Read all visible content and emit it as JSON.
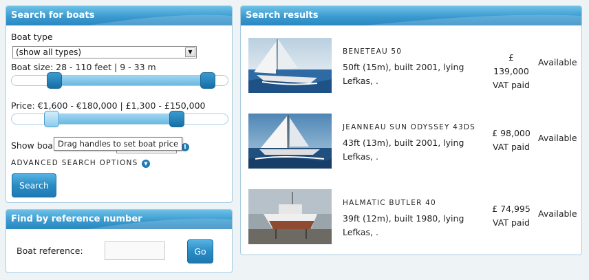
{
  "search_panel": {
    "title": "Search for boats",
    "boat_type_label": "Boat type",
    "boat_type_value": "(show all types)",
    "boat_size_label": "Boat size: 28 - 110 feet | 9 - 33 m",
    "price_label": "Price: €1,600 - €180,000 | £1,300 - £150,000",
    "show_label": "Show boa",
    "tooltip": "Drag handles to set boat price",
    "advanced_label": "ADVANCED SEARCH OPTIONS",
    "search_button": "Search"
  },
  "reference_panel": {
    "title": "Find by reference number",
    "reference_label": "Boat reference:",
    "reference_value": "",
    "go_button": "Go"
  },
  "results_panel": {
    "title": "Search results",
    "results": [
      {
        "name": "BENETEAU 50",
        "desc": "50ft (15m), built 2001, lying Lefkas, .",
        "price_line1": "£",
        "price_line2": "139,000",
        "price_line3": "VAT paid",
        "availability": "Available"
      },
      {
        "name": "JEANNEAU SUN ODYSSEY 43DS",
        "desc": "43ft (13m), built 2001, lying Lefkas, .",
        "price_line1": "£ 98,000",
        "price_line2": "VAT paid",
        "price_line3": "",
        "availability": "Available"
      },
      {
        "name": "HALMATIC BUTLER 40",
        "desc": "39ft (12m), built 1980, lying Lefkas, .",
        "price_line1": "£ 74,995",
        "price_line2": "VAT paid",
        "price_line3": "",
        "availability": "Available"
      }
    ]
  },
  "colors": {
    "header_blue": "#3a9bd0",
    "button_blue": "#2a8cc5",
    "border": "#a6cbe1"
  }
}
